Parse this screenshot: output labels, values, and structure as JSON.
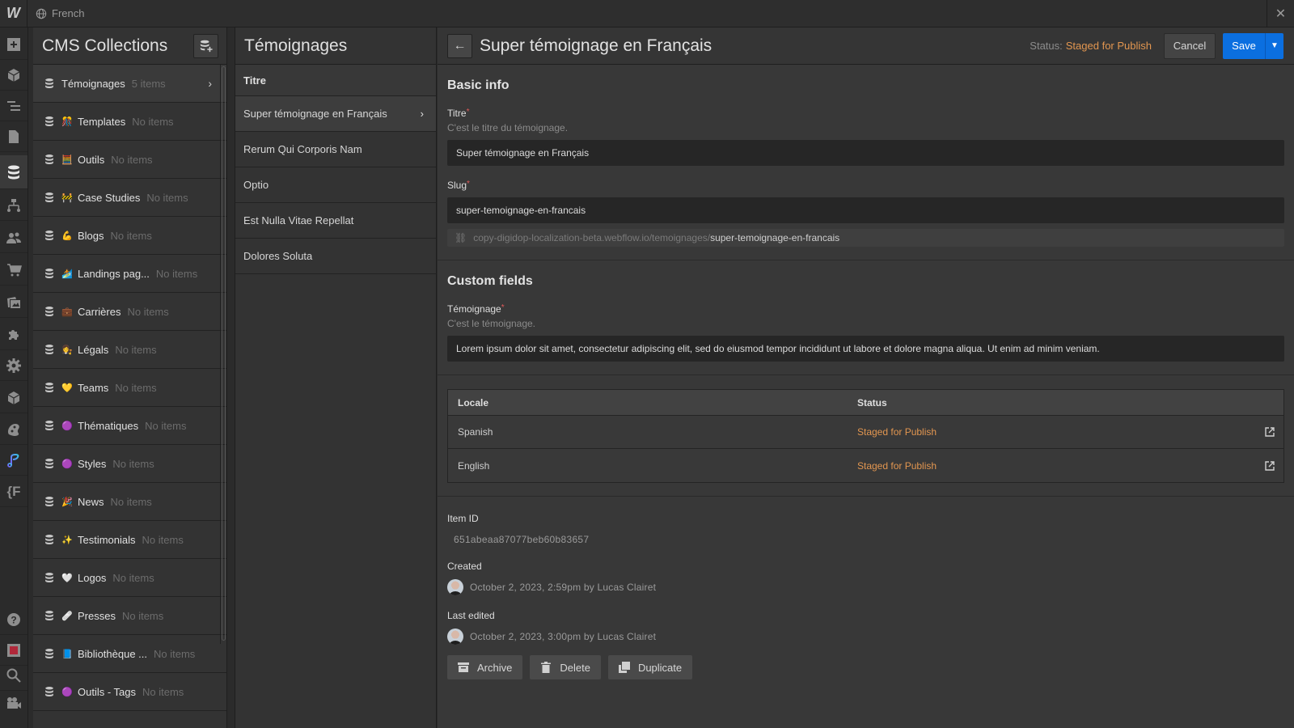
{
  "topbar": {
    "logo": "W",
    "locale": "French",
    "globe_icon": "globe-icon",
    "close_icon": "close-icon"
  },
  "icon_rail": [
    {
      "name": "add-panel-icon",
      "active": false
    },
    {
      "name": "components-icon",
      "active": false
    },
    {
      "name": "navigator-icon",
      "active": false
    },
    {
      "name": "pages-icon",
      "active": false
    },
    {
      "name": "cms-icon",
      "active": true
    },
    {
      "name": "logic-icon",
      "active": false
    },
    {
      "name": "users-icon",
      "active": false
    },
    {
      "name": "ecommerce-icon",
      "active": false
    },
    {
      "name": "assets-icon",
      "active": false
    },
    {
      "name": "apps-icon",
      "active": false
    },
    {
      "name": "settings-icon",
      "active": false
    },
    {
      "name": "libraries-icon",
      "active": false
    },
    {
      "name": "style-palette-icon",
      "active": false
    },
    {
      "name": "app-extension-icon",
      "active": false
    },
    {
      "name": "finsweet-icon",
      "active": false
    }
  ],
  "icon_rail_bottom": [
    {
      "name": "help-icon"
    },
    {
      "name": "record-icon"
    },
    {
      "name": "search-icon"
    },
    {
      "name": "video-tutorials-icon"
    }
  ],
  "cms": {
    "title": "CMS Collections",
    "add_collection_icon": "add-collection-icon",
    "collections": [
      {
        "emoji": "",
        "name": "Témoignages",
        "count": "5 items",
        "has_chevron": true
      },
      {
        "emoji": "🎊",
        "name": "Templates",
        "count": "No items"
      },
      {
        "emoji": "🧮",
        "name": "Outils",
        "count": "No items"
      },
      {
        "emoji": "🚧",
        "name": "Case Studies",
        "count": "No items"
      },
      {
        "emoji": "💪",
        "name": "Blogs",
        "count": "No items"
      },
      {
        "emoji": "🏄",
        "name": "Landings pag...",
        "count": "No items"
      },
      {
        "emoji": "💼",
        "name": "Carrières",
        "count": "No items"
      },
      {
        "emoji": "👩‍⚖️",
        "name": "Légals",
        "count": "No items"
      },
      {
        "emoji": "💛",
        "name": "Teams",
        "count": "No items"
      },
      {
        "emoji": "🟣",
        "name": "Thématiques",
        "count": "No items"
      },
      {
        "emoji": "🟣",
        "name": "Styles",
        "count": "No items"
      },
      {
        "emoji": "🎉",
        "name": "News",
        "count": "No items"
      },
      {
        "emoji": "✨",
        "name": "Testimonials",
        "count": "No items"
      },
      {
        "emoji": "🤍",
        "name": "Logos",
        "count": "No items"
      },
      {
        "emoji": "🩹",
        "name": "Presses",
        "count": "No items"
      },
      {
        "emoji": "📘",
        "name": "Bibliothèque ...",
        "count": "No items"
      },
      {
        "emoji": "🟣",
        "name": "Outils - Tags",
        "count": "No items"
      }
    ]
  },
  "items_panel": {
    "title": "Témoignages",
    "column": "Titre",
    "items": [
      {
        "title": "Super témoignage en Français",
        "selected": true
      },
      {
        "title": "Rerum Qui Corporis Nam",
        "selected": false
      },
      {
        "title": "Optio",
        "selected": false
      },
      {
        "title": "Est Nulla Vitae Repellat",
        "selected": false
      },
      {
        "title": "Dolores Soluta",
        "selected": false
      }
    ]
  },
  "detail": {
    "title": "Super témoignage en Français",
    "status_label": "Status:",
    "status_value": "Staged for Publish",
    "cancel_label": "Cancel",
    "save_label": "Save",
    "colors": {
      "accent": "#0b6fe0",
      "staged": "#e29650",
      "required": "#e05a5a"
    },
    "basic_info": {
      "heading": "Basic info",
      "titre": {
        "label": "Titre",
        "required": "*",
        "help": "C'est le titre du témoignage.",
        "value": "Super témoignage en Français"
      },
      "slug": {
        "label": "Slug",
        "required": "*",
        "value": "super-temoignage-en-francais",
        "url_prefix": "copy-digidop-localization-beta.webflow.io/temoignages/",
        "url_slug": "super-temoignage-en-francais"
      }
    },
    "custom_fields": {
      "heading": "Custom fields",
      "temoignage": {
        "label": "Témoignage",
        "required": "*",
        "help": "C'est le témoignage.",
        "value": "Lorem ipsum dolor sit amet, consectetur adipiscing elit, sed do eiusmod tempor incididunt ut labore et dolore magna aliqua. Ut enim ad minim veniam."
      }
    },
    "locales": {
      "headers": [
        "Locale",
        "Status"
      ],
      "rows": [
        {
          "locale": "Spanish",
          "status": "Staged for Publish"
        },
        {
          "locale": "English",
          "status": "Staged for Publish"
        }
      ]
    },
    "meta": {
      "item_id_label": "Item ID",
      "item_id": "651abeaa87077beb60b83657",
      "created_label": "Created",
      "created": "October 2, 2023, 2:59pm by Lucas Clairet",
      "edited_label": "Last edited",
      "edited": "October 2, 2023, 3:00pm by Lucas Clairet"
    },
    "actions": {
      "archive": "Archive",
      "delete": "Delete",
      "duplicate": "Duplicate"
    }
  }
}
